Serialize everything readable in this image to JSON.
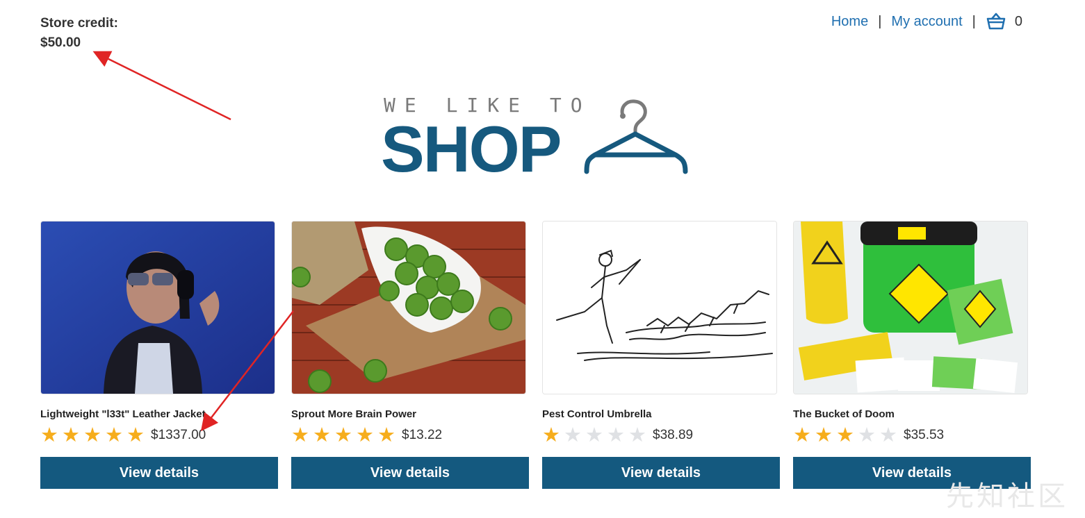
{
  "store_credit": {
    "label": "Store credit:",
    "amount": "$50.00"
  },
  "nav": {
    "home": "Home",
    "separator": "|",
    "account": "My account",
    "cart_icon": "basket-icon",
    "cart_count": "0"
  },
  "logo": {
    "tagline": "WE LIKE TO",
    "word": "SHOP",
    "icon": "hanger-icon"
  },
  "products": [
    {
      "name": "Lightweight \"l33t\" Leather Jacket",
      "rating": 5,
      "price": "$1337.00",
      "button": "View details",
      "image": "person-with-headphones-image"
    },
    {
      "name": "Sprout More Brain Power",
      "rating": 5,
      "price": "$13.22",
      "button": "View details",
      "image": "brussels-sprouts-image"
    },
    {
      "name": "Pest Control Umbrella",
      "rating": 1,
      "price": "$38.89",
      "button": "View details",
      "image": "umbrella-sketch-image"
    },
    {
      "name": "The Bucket of Doom",
      "rating": 3,
      "price": "$35.53",
      "button": "View details",
      "image": "bucket-of-doom-image"
    }
  ],
  "watermark": "先知社区",
  "colors": {
    "accent": "#14597f",
    "link": "#1f6fb0",
    "star": "#f6ad1c",
    "annotation": "#e02424"
  }
}
